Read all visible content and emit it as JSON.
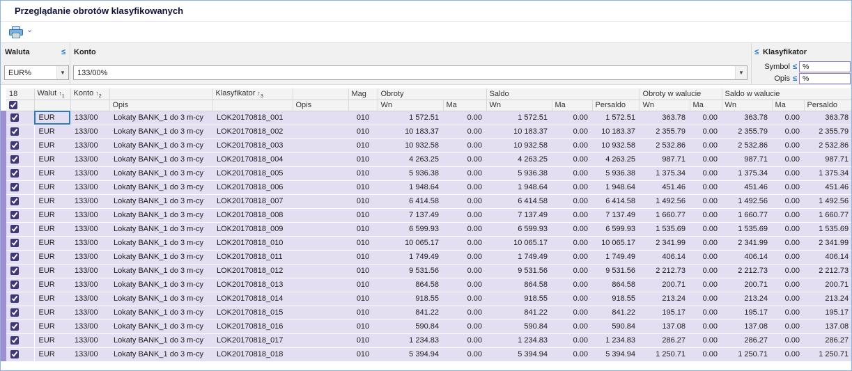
{
  "window": {
    "title": "Przeglądanie obrotów klasyfikowanych"
  },
  "toolbar": {
    "print_icon": "printer-icon",
    "dropdown_icon": "chevron-down"
  },
  "filters": {
    "waluta": {
      "label": "Waluta",
      "operator": "≤",
      "value": "EUR%"
    },
    "konto": {
      "label": "Konto",
      "value": "133/00%"
    },
    "klasyfikator": {
      "operator": "≤",
      "label": "Klasyfikator",
      "symbol": {
        "label": "Symbol",
        "operator": "≤",
        "value": "%"
      },
      "opis": {
        "label": "Opis",
        "operator": "≤",
        "value": "%"
      }
    }
  },
  "colors": {
    "row_bg": "#e3def1",
    "indicator_strip": "#9d8fd2",
    "focus_blue": "#2e79c7",
    "operator_blue": "#2e79c7"
  },
  "table": {
    "count": "18",
    "header": {
      "walut": "Walut",
      "walut_sort": "1",
      "konto": "Konto",
      "konto_sort": "2",
      "opis": "Opis",
      "klasyfikator": "Klasyfikator",
      "klasyfikator_sort": "3",
      "opis2": "Opis",
      "mag": "Mag",
      "obroty": "Obroty",
      "saldo": "Saldo",
      "obroty_w_walucie": "Obroty w walucie",
      "saldo_w_walucie": "Saldo w walucie",
      "wn": "Wn",
      "ma": "Ma",
      "persaldo": "Persaldo"
    },
    "columns": [
      "walut",
      "konto",
      "opis",
      "klasyfikator",
      "opis2",
      "mag",
      "obroty_wn",
      "obroty_ma",
      "saldo_wn",
      "saldo_ma",
      "persaldo",
      "obroty_wal_wn",
      "obroty_wal_ma",
      "saldo_wal_wn",
      "saldo_wal_ma",
      "persaldo_wal"
    ],
    "rows": [
      [
        "EUR",
        "133/00",
        "Lokaty BANK_1 do 3 m-cy",
        "LOK20170818_001",
        "",
        "010",
        "1 572.51",
        "0.00",
        "1 572.51",
        "0.00",
        "1 572.51",
        "363.78",
        "0.00",
        "363.78",
        "0.00",
        "363.78"
      ],
      [
        "EUR",
        "133/00",
        "Lokaty BANK_1 do 3 m-cy",
        "LOK20170818_002",
        "",
        "010",
        "10 183.37",
        "0.00",
        "10 183.37",
        "0.00",
        "10 183.37",
        "2 355.79",
        "0.00",
        "2 355.79",
        "0.00",
        "2 355.79"
      ],
      [
        "EUR",
        "133/00",
        "Lokaty BANK_1 do 3 m-cy",
        "LOK20170818_003",
        "",
        "010",
        "10 932.58",
        "0.00",
        "10 932.58",
        "0.00",
        "10 932.58",
        "2 532.86",
        "0.00",
        "2 532.86",
        "0.00",
        "2 532.86"
      ],
      [
        "EUR",
        "133/00",
        "Lokaty BANK_1 do 3 m-cy",
        "LOK20170818_004",
        "",
        "010",
        "4 263.25",
        "0.00",
        "4 263.25",
        "0.00",
        "4 263.25",
        "987.71",
        "0.00",
        "987.71",
        "0.00",
        "987.71"
      ],
      [
        "EUR",
        "133/00",
        "Lokaty BANK_1 do 3 m-cy",
        "LOK20170818_005",
        "",
        "010",
        "5 936.38",
        "0.00",
        "5 936.38",
        "0.00",
        "5 936.38",
        "1 375.34",
        "0.00",
        "1 375.34",
        "0.00",
        "1 375.34"
      ],
      [
        "EUR",
        "133/00",
        "Lokaty BANK_1 do 3 m-cy",
        "LOK20170818_006",
        "",
        "010",
        "1 948.64",
        "0.00",
        "1 948.64",
        "0.00",
        "1 948.64",
        "451.46",
        "0.00",
        "451.46",
        "0.00",
        "451.46"
      ],
      [
        "EUR",
        "133/00",
        "Lokaty BANK_1 do 3 m-cy",
        "LOK20170818_007",
        "",
        "010",
        "6 414.58",
        "0.00",
        "6 414.58",
        "0.00",
        "6 414.58",
        "1 492.56",
        "0.00",
        "1 492.56",
        "0.00",
        "1 492.56"
      ],
      [
        "EUR",
        "133/00",
        "Lokaty BANK_1 do 3 m-cy",
        "LOK20170818_008",
        "",
        "010",
        "7 137.49",
        "0.00",
        "7 137.49",
        "0.00",
        "7 137.49",
        "1 660.77",
        "0.00",
        "1 660.77",
        "0.00",
        "1 660.77"
      ],
      [
        "EUR",
        "133/00",
        "Lokaty BANK_1 do 3 m-cy",
        "LOK20170818_009",
        "",
        "010",
        "6 599.93",
        "0.00",
        "6 599.93",
        "0.00",
        "6 599.93",
        "1 535.69",
        "0.00",
        "1 535.69",
        "0.00",
        "1 535.69"
      ],
      [
        "EUR",
        "133/00",
        "Lokaty BANK_1 do 3 m-cy",
        "LOK20170818_010",
        "",
        "010",
        "10 065.17",
        "0.00",
        "10 065.17",
        "0.00",
        "10 065.17",
        "2 341.99",
        "0.00",
        "2 341.99",
        "0.00",
        "2 341.99"
      ],
      [
        "EUR",
        "133/00",
        "Lokaty BANK_1 do 3 m-cy",
        "LOK20170818_011",
        "",
        "010",
        "1 749.49",
        "0.00",
        "1 749.49",
        "0.00",
        "1 749.49",
        "406.14",
        "0.00",
        "406.14",
        "0.00",
        "406.14"
      ],
      [
        "EUR",
        "133/00",
        "Lokaty BANK_1 do 3 m-cy",
        "LOK20170818_012",
        "",
        "010",
        "9 531.56",
        "0.00",
        "9 531.56",
        "0.00",
        "9 531.56",
        "2 212.73",
        "0.00",
        "2 212.73",
        "0.00",
        "2 212.73"
      ],
      [
        "EUR",
        "133/00",
        "Lokaty BANK_1 do 3 m-cy",
        "LOK20170818_013",
        "",
        "010",
        "864.58",
        "0.00",
        "864.58",
        "0.00",
        "864.58",
        "200.71",
        "0.00",
        "200.71",
        "0.00",
        "200.71"
      ],
      [
        "EUR",
        "133/00",
        "Lokaty BANK_1 do 3 m-cy",
        "LOK20170818_014",
        "",
        "010",
        "918.55",
        "0.00",
        "918.55",
        "0.00",
        "918.55",
        "213.24",
        "0.00",
        "213.24",
        "0.00",
        "213.24"
      ],
      [
        "EUR",
        "133/00",
        "Lokaty BANK_1 do 3 m-cy",
        "LOK20170818_015",
        "",
        "010",
        "841.22",
        "0.00",
        "841.22",
        "0.00",
        "841.22",
        "195.17",
        "0.00",
        "195.17",
        "0.00",
        "195.17"
      ],
      [
        "EUR",
        "133/00",
        "Lokaty BANK_1 do 3 m-cy",
        "LOK20170818_016",
        "",
        "010",
        "590.84",
        "0.00",
        "590.84",
        "0.00",
        "590.84",
        "137.08",
        "0.00",
        "137.08",
        "0.00",
        "137.08"
      ],
      [
        "EUR",
        "133/00",
        "Lokaty BANK_1 do 3 m-cy",
        "LOK20170818_017",
        "",
        "010",
        "1 234.83",
        "0.00",
        "1 234.83",
        "0.00",
        "1 234.83",
        "286.27",
        "0.00",
        "286.27",
        "0.00",
        "286.27"
      ],
      [
        "EUR",
        "133/00",
        "Lokaty BANK_1 do 3 m-cy",
        "LOK20170818_018",
        "",
        "010",
        "5 394.94",
        "0.00",
        "5 394.94",
        "0.00",
        "5 394.94",
        "1 250.71",
        "0.00",
        "1 250.71",
        "0.00",
        "1 250.71"
      ]
    ]
  }
}
